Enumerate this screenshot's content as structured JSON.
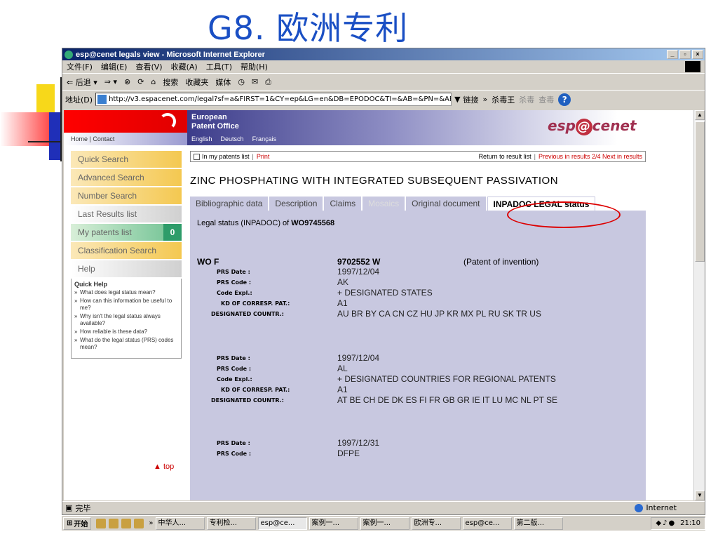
{
  "slide": {
    "title": "G8. 欧洲专利"
  },
  "window": {
    "title": "esp@cenet legals view - Microsoft Internet Explorer",
    "controls": [
      "_",
      "▫",
      "×"
    ]
  },
  "menu": [
    "文件(F)",
    "编辑(E)",
    "查看(V)",
    "收藏(A)",
    "工具(T)",
    "帮助(H)"
  ],
  "toolbar": {
    "back": "⇐ 后退 ▾",
    "forward": "⇒ ▾",
    "search": "搜索",
    "favorites": "收藏夹",
    "media": "媒体"
  },
  "address": {
    "label": "地址(D)",
    "url": "http://v3.espacenet.com/legal?sf=a&FIRST=1&CY=ep&LG=en&DB=EPODOC&TI=&AB=&PN=&AP=&PR=&PD=&PA=Mayer+Cie+GmbH+&I",
    "links": "链接",
    "kill": "杀毒王",
    "kill2": "杀毒",
    "scan": "查毒"
  },
  "epo": {
    "name_line1": "European",
    "name_line2": "Patent Office",
    "home": "Home | Contact",
    "languages": [
      "English",
      "Deutsch",
      "Français"
    ],
    "brand_pre": "esp",
    "brand_at": "@",
    "brand_post": "cenet"
  },
  "nav": {
    "items": [
      "Quick Search",
      "Advanced Search",
      "Number Search",
      "Last Results list",
      "My patents list",
      "Classification Search",
      "Help"
    ],
    "my_patents_count": "0",
    "quick_help_title": "Quick Help",
    "quick_help": [
      "What does legal status mean?",
      "How can this information be useful to me?",
      "Why isn't the legal status always available?",
      "How reliable is these data?",
      "What do the legal status (PRS) codes mean?"
    ],
    "top": "▲ top"
  },
  "util": {
    "my_list": "In my patents list",
    "print": "Print",
    "return": "Return to result list",
    "prev": "Previous in results 2/4 Next in results"
  },
  "doc": {
    "title": "ZINC PHOSPHATING WITH INTEGRATED SUBSEQUENT PASSIVATION",
    "tabs": [
      "Bibliographic data",
      "Description",
      "Claims",
      "Mosaics",
      "Original document",
      "INPADOC LEGAL status"
    ],
    "legal_prefix": "Legal status (INPADOC) of ",
    "legal_number": "WO9745568",
    "head_c1": "WO F",
    "head_c2": "9702552  W",
    "head_c3": "(Patent of invention)",
    "labels": {
      "prs_date": "PRS Date :",
      "prs_code": "PRS Code :",
      "code_expl": "Code Expl.:",
      "kd": "KD OF CORRESP. PAT.:",
      "designated": "DESIGNATED COUNTR.:"
    },
    "records": [
      {
        "date": "1997/12/04",
        "code": "AK",
        "expl": "+ DESIGNATED STATES",
        "kd": "A1",
        "countries": "AU BR BY CA CN CZ HU JP KR MX PL RU SK TR US"
      },
      {
        "date": "1997/12/04",
        "code": "AL",
        "expl": "+ DESIGNATED COUNTRIES FOR REGIONAL PATENTS",
        "kd": "A1",
        "countries": "AT BE CH DE DK ES FI FR GB GR IE IT LU MC NL PT SE"
      },
      {
        "date": "1997/12/31",
        "code": "DFPE"
      }
    ]
  },
  "status": {
    "text": "完毕",
    "zone": "Internet"
  },
  "taskbar": {
    "start": "开始",
    "tasks": [
      "中华人...",
      "专利检...",
      "esp@ce...",
      "案例一...",
      "案例一...",
      "欧洲专...",
      "esp@ce...",
      "第二版..."
    ],
    "time": "21:10"
  }
}
